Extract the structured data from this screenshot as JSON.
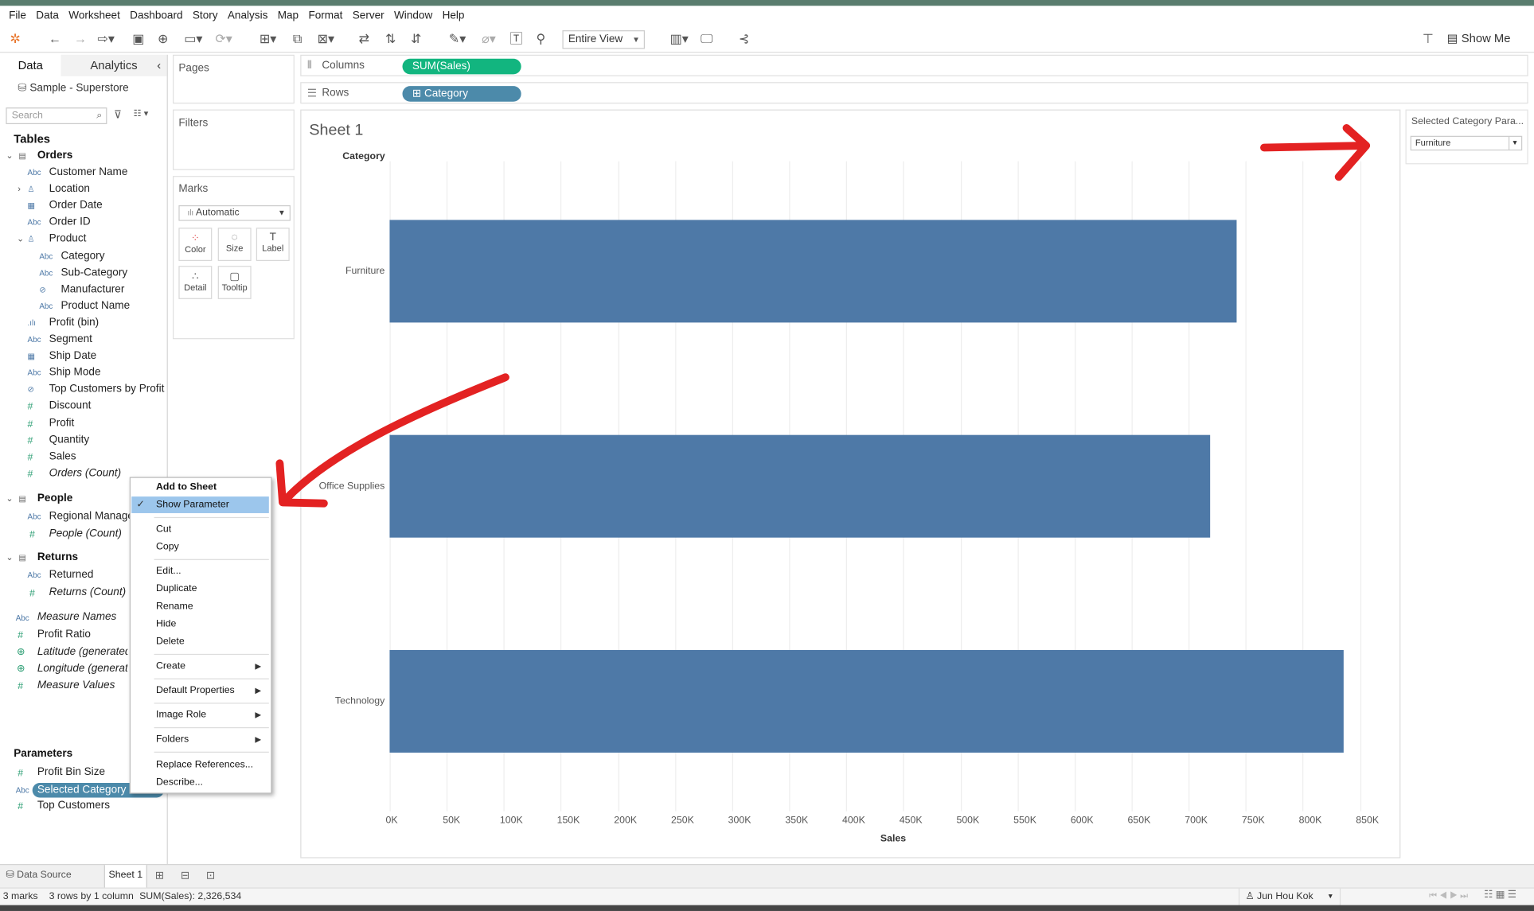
{
  "menu": [
    "File",
    "Data",
    "Worksheet",
    "Dashboard",
    "Story",
    "Analysis",
    "Map",
    "Format",
    "Server",
    "Window",
    "Help"
  ],
  "toolbar": {
    "view_dropdown": "Entire View",
    "show_me": "Show Me"
  },
  "left": {
    "tab_data": "Data",
    "tab_analytics": "Analytics",
    "datasource": "Sample - Superstore",
    "search_placeholder": "Search",
    "tables_header": "Tables",
    "orders": {
      "name": "Orders",
      "fields": [
        "Customer Name",
        "Location",
        "Order Date",
        "Order ID",
        "Product",
        "Category",
        "Sub-Category",
        "Manufacturer",
        "Product Name",
        "Profit (bin)",
        "Segment",
        "Ship Date",
        "Ship Mode",
        "Top Customers by Profit",
        "Discount",
        "Profit",
        "Quantity",
        "Sales",
        "Orders (Count)"
      ]
    },
    "people": {
      "name": "People",
      "fields": [
        "Regional Manager",
        "People (Count)"
      ]
    },
    "returns": {
      "name": "Returns",
      "fields": [
        "Returned",
        "Returns (Count)"
      ]
    },
    "extras": [
      "Measure Names",
      "Profit Ratio",
      "Latitude (generated)",
      "Longitude (generated)",
      "Measure Values"
    ],
    "parameters_header": "Parameters",
    "parameters": [
      "Profit Bin Size",
      "Selected Category Parameter",
      "Top Customers"
    ],
    "type_icons": {
      "abc": "Abc",
      "measure": "#",
      "bin": ".ılı",
      "date": "▦",
      "hier": "♙",
      "set": "⊘",
      "geo": "⊕",
      "table": "▤",
      "group": "⊘"
    }
  },
  "cards": {
    "pages": "Pages",
    "filters": "Filters",
    "marks": "Marks",
    "mark_type": "Automatic",
    "mark_buttons": [
      {
        "icon": "⁘",
        "label": "Color"
      },
      {
        "icon": "◌",
        "label": "Size"
      },
      {
        "icon": "T",
        "label": "Label"
      },
      {
        "icon": "∴",
        "label": "Detail"
      },
      {
        "icon": "▢",
        "label": "Tooltip"
      }
    ]
  },
  "shelves": {
    "columns_label": "Columns",
    "rows_label": "Rows",
    "columns_pill": "SUM(Sales)",
    "rows_pill": "⊞ Category",
    "columns_icon": "⦀",
    "rows_icon": "☰"
  },
  "view": {
    "sheet_title": "Sheet 1",
    "row_header": "Category"
  },
  "chart_data": {
    "type": "bar",
    "orientation": "horizontal",
    "categories": [
      "Furniture",
      "Office Supplies",
      "Technology"
    ],
    "values": [
      742000,
      719047,
      836154
    ],
    "xlabel": "Sales",
    "ylabel": "Category",
    "xticks": [
      "0K",
      "50K",
      "100K",
      "150K",
      "200K",
      "250K",
      "300K",
      "350K",
      "400K",
      "450K",
      "500K",
      "550K",
      "600K",
      "650K",
      "700K",
      "750K",
      "800K",
      "850K"
    ],
    "xlim": [
      0,
      880000
    ],
    "grid": true,
    "color": "#4e79a7"
  },
  "parameter_card": {
    "title": "Selected Category Para...",
    "value": "Furniture"
  },
  "context_menu": {
    "items": [
      {
        "label": "Add to Sheet",
        "bold": true
      },
      {
        "label": "Show Parameter",
        "checked": true,
        "highlighted": true
      },
      {
        "label": "Cut"
      },
      {
        "label": "Copy"
      },
      {
        "label": "Edit..."
      },
      {
        "label": "Duplicate"
      },
      {
        "label": "Rename"
      },
      {
        "label": "Hide"
      },
      {
        "label": "Delete"
      },
      {
        "label": "Create",
        "submenu": true
      },
      {
        "label": "Default Properties",
        "submenu": true
      },
      {
        "label": "Image Role",
        "submenu": true
      },
      {
        "label": "Folders",
        "submenu": true
      },
      {
        "label": "Replace References..."
      },
      {
        "label": "Describe..."
      }
    ]
  },
  "bottom": {
    "data_source": "Data Source",
    "sheet_tab": "Sheet 1"
  },
  "status": {
    "marks": "3 marks",
    "rows": "3 rows by 1 column",
    "sum": "SUM(Sales): 2,326,534",
    "user": "Jun Hou Kok"
  },
  "annotation_color": "#e32222"
}
